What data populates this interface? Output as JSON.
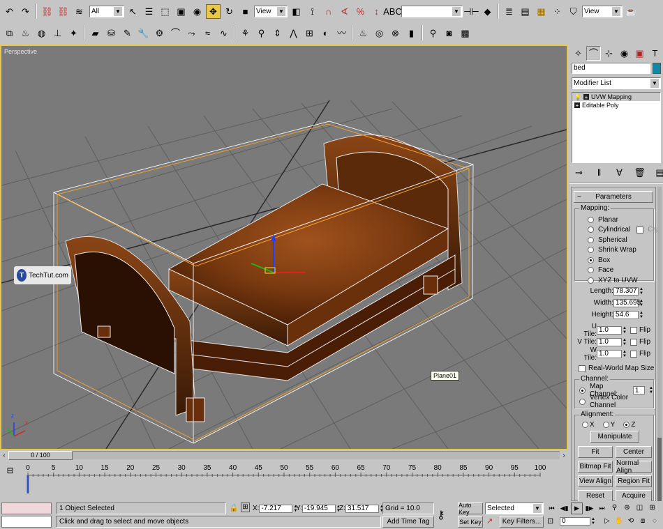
{
  "toolbar": {
    "filter_value": "All",
    "view_label": "View",
    "named_selection_value": "",
    "right_view_label": "View"
  },
  "viewport": {
    "label": "Perspective",
    "watermark": "TechTut.com",
    "tooltip": "Plane01",
    "axis_x": "x",
    "axis_z": "z"
  },
  "command_panel": {
    "object_name": "bed",
    "object_color": "#0e8aa8",
    "modifier_list": "Modifier List",
    "stack": [
      "UVW Mapping",
      "Editable Poly"
    ],
    "rollout_title": "Parameters",
    "mapping": {
      "label": "Mapping:",
      "options": [
        "Planar",
        "Cylindrical",
        "Spherical",
        "Shrink Wrap",
        "Box",
        "Face",
        "XYZ to UVW"
      ],
      "selected": "Box",
      "cap_label": "Cap"
    },
    "length_label": "Length:",
    "length_value": "78.307",
    "width_label": "Width:",
    "width_value": "135.695",
    "height_label": "Height:",
    "height_value": "54.6",
    "utile_label": "U Tile:",
    "utile_value": "1.0",
    "vtile_label": "V Tile:",
    "vtile_value": "1.0",
    "wtile_label": "W Tile:",
    "wtile_value": "1.0",
    "flip_label": "Flip",
    "real_world_label": "Real-World Map Size",
    "channel": {
      "label": "Channel:",
      "map_channel_label": "Map Channel:",
      "map_channel_value": "1",
      "vertex_color_label": "Vertex Color Channel"
    },
    "alignment": {
      "label": "Alignment:",
      "x": "X",
      "y": "Y",
      "z": "Z",
      "manipulate": "Manipulate",
      "fit": "Fit",
      "center": "Center",
      "bitmap_fit": "Bitmap Fit",
      "normal_align": "Normal Align",
      "view_align": "View Align",
      "region_fit": "Region Fit",
      "reset": "Reset",
      "acquire": "Acquire"
    }
  },
  "timeline": {
    "slider_label": "0 / 100",
    "ticks": [
      "0",
      "5",
      "10",
      "15",
      "20",
      "25",
      "30",
      "35",
      "40",
      "45",
      "50",
      "55",
      "60",
      "65",
      "70",
      "75",
      "80",
      "85",
      "90",
      "95",
      "100"
    ]
  },
  "status": {
    "selection": "1 Object Selected",
    "prompt": "Click and drag to select and move objects",
    "x_label": "X:",
    "x_value": "-7.217",
    "y_label": "Y:",
    "y_value": "-19.945",
    "z_label": "Z:",
    "z_value": "31.517",
    "grid": "Grid = 10.0",
    "add_time_tag": "Add Time Tag",
    "auto_key": "Auto Key",
    "set_key": "Set Key",
    "key_mode": "Selected",
    "key_filters": "Key Filters...",
    "frame": "0"
  }
}
